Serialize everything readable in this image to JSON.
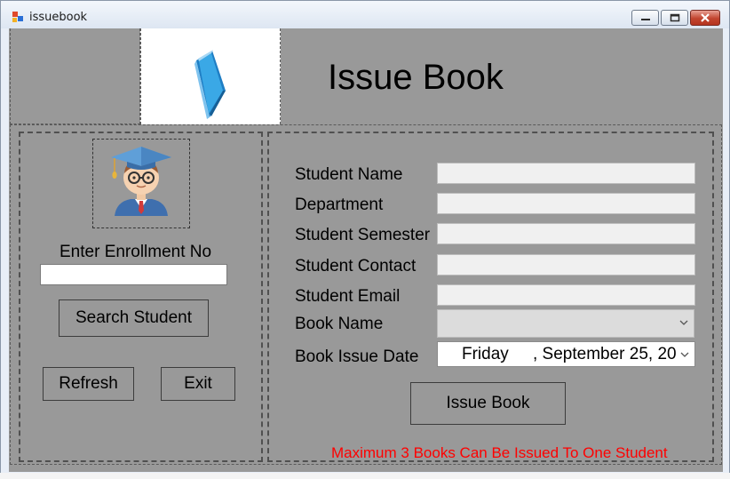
{
  "window": {
    "title": "issuebook",
    "icons": {
      "app": "app-icon",
      "minimize": "minimize-icon",
      "maximize": "maximize-icon",
      "close": "close-icon"
    }
  },
  "header": {
    "title": "Issue Book",
    "logo_icon": "book-icon"
  },
  "left_panel": {
    "avatar_icon": "student-avatar-icon",
    "enrollment_label": "Enter Enrollment No",
    "enrollment_value": "",
    "search_button": "Search Student",
    "refresh_button": "Refresh",
    "exit_button": "Exit"
  },
  "form": {
    "fields": [
      {
        "label": "Student Name",
        "value": ""
      },
      {
        "label": "Department",
        "value": ""
      },
      {
        "label": "Student Semester",
        "value": ""
      },
      {
        "label": "Student Contact",
        "value": ""
      },
      {
        "label": "Student Email",
        "value": ""
      }
    ],
    "book_name_label": "Book Name",
    "book_name_value": "",
    "issue_date_label": "Book Issue Date",
    "issue_date_day": "Friday",
    "issue_date_rest": ", September 25, 20",
    "issue_button": "Issue Book",
    "warning": "Maximum 3 Books Can Be Issued To  One Student"
  },
  "colors": {
    "panel_bg": "#999999",
    "warning": "#ff0000",
    "book_blue": "#3aa8e6"
  }
}
